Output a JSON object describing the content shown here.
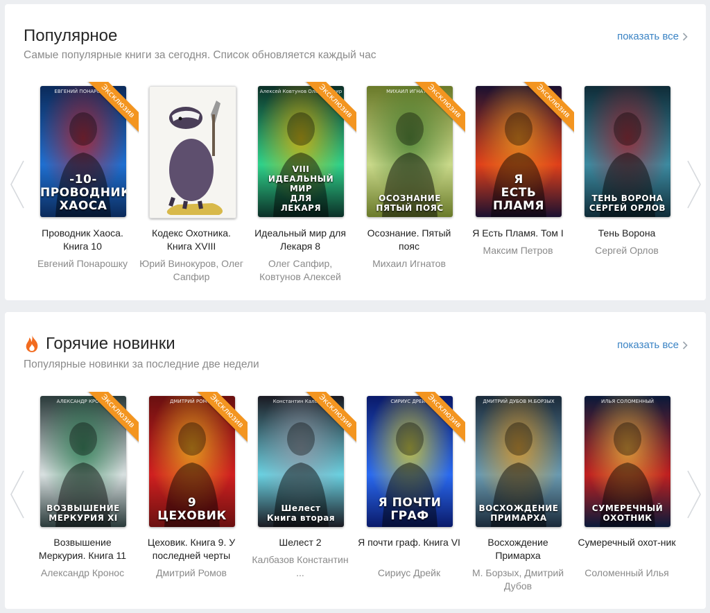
{
  "sections": [
    {
      "title": "Популярное",
      "subtitle": "Самые популярные книги за сегодня. Список обновляется каждый час",
      "show_all": "показать все",
      "books": [
        {
          "title": "Проводник Хаоса. Книга 10",
          "author": "Евгений Понарошку",
          "exclusive": "Эксклюзив",
          "cover_top": "ЕВГЕНИЙ ПОНАРОШКУ",
          "cover_text": "-10-\nПРОВОДНИК\nХАОСА",
          "palette": [
            "#0b2a5a",
            "#1f6fd0",
            "#c81e1e"
          ]
        },
        {
          "title": "Кодекс Охотника. Книга XVIII",
          "author": "Юрий Винокуров, Олег Сапфир",
          "exclusive": "",
          "cover_top": "",
          "cover_text": "",
          "palette": [
            "#f4f3ef",
            "#5c4b6e",
            "#d8b94a"
          ]
        },
        {
          "title": "Идеальный мир для Лекаря 8",
          "author": "Олег Сапфир, Ковтунов Алексей",
          "exclusive": "Эксклюзив",
          "cover_top": "Алексей Ковтунов    Олег Сапфир",
          "cover_text": "VIII\nИДЕАЛЬНЫЙ МИР\nДЛЯ\nЛЕКАРЯ",
          "palette": [
            "#0b2f27",
            "#2fd18a",
            "#f2b100"
          ]
        },
        {
          "title": "Осознание. Пятый пояс",
          "author": "Михаил Игнатов",
          "exclusive": "Эксклюзив",
          "cover_top": "МИХАИЛ ИГНАТОВ",
          "cover_text": "ОСОЗНАНИЕ\nПЯТЫЙ ПОЯС",
          "palette": [
            "#6a7a2a",
            "#c9d98a",
            "#3d7a2c"
          ]
        },
        {
          "title": "Я Есть Пламя. Том I",
          "author": "Максим Петров",
          "exclusive": "Эксклюзив",
          "cover_top": "",
          "cover_text": "Я\nЕСТЬ\nПЛАМЯ",
          "palette": [
            "#1a1030",
            "#e0401a",
            "#f0a020"
          ]
        },
        {
          "title": "Тень Ворона",
          "author": "Сергей Орлов",
          "exclusive": "",
          "cover_top": "",
          "cover_text": "ТЕНЬ ВОРОНА\nСЕРГЕЙ ОРЛОВ",
          "palette": [
            "#0f2c38",
            "#3d8aa0",
            "#b01f2a"
          ]
        }
      ]
    },
    {
      "title": "Горячие новинки",
      "subtitle": "Популярные новинки за последние две недели",
      "show_all": "показать все",
      "books": [
        {
          "title": "Возвышение Меркурия. Книга 11",
          "author": "Александр Кронос",
          "exclusive": "Эксклюзив",
          "cover_top": "АЛЕКСАНДР КРОНОС",
          "cover_text": "ВОЗВЫШЕНИЕ\nМЕРКУРИЯ XI",
          "palette": [
            "#2a3a3a",
            "#d8e0e0",
            "#1f7a4a"
          ]
        },
        {
          "title": "Цеховик. Книга 9. У последней черты",
          "author": "Дмитрий Ромов",
          "exclusive": "Эксклюзив",
          "cover_top": "ДМИТРИЙ РОМОВ",
          "cover_text": "9\nЦЕХОВИК",
          "palette": [
            "#6a1010",
            "#d02020",
            "#f0c020"
          ]
        },
        {
          "title": "Шелест 2",
          "author": "Калбазов Константин\n...",
          "exclusive": "Эксклюзив",
          "cover_top": "Константин Калбазов",
          "cover_text": "Шелест\nКнига вторая",
          "palette": [
            "#1a1a22",
            "#6ad0e0",
            "#9a9aa8"
          ]
        },
        {
          "title": "Я почти граф. Книга VI",
          "author": "Сириус Дрейк",
          "exclusive": "Эксклюзив",
          "cover_top": "СИРИУС ДРЕЙК",
          "cover_text": "Я ПОЧТИ\nГРАФ",
          "palette": [
            "#0a1a6a",
            "#2a6af0",
            "#f0e020"
          ]
        },
        {
          "title": "Восхождение Примарха",
          "author": "М. Борзых, Дмитрий Дубов",
          "exclusive": "",
          "cover_top": "ДМИТРИЙ ДУБОВ    М.БОРЗЫХ",
          "cover_text": "ВОСХОЖДЕНИЕ\nПРИМАРХА",
          "palette": [
            "#1a2a3a",
            "#6a9ab0",
            "#f0a020"
          ]
        },
        {
          "title": "Сумеречный охот-ник",
          "author": "Соломенный Илья",
          "exclusive": "",
          "cover_top": "ИЛЬЯ СОЛОМЕННЫЙ",
          "cover_text": "СУМЕРЕЧНЫЙ\nОХОТНИК",
          "palette": [
            "#0a1a3a",
            "#c02020",
            "#f0c040"
          ]
        }
      ]
    }
  ],
  "icons": {
    "prev": "chevron-left-icon",
    "next": "chevron-right-icon",
    "fire": "fire-icon",
    "show_all": "chevron-right-icon"
  },
  "colors": {
    "link": "#3a83c4",
    "ribbon": "#f39520",
    "fire": "#f26b1f"
  }
}
